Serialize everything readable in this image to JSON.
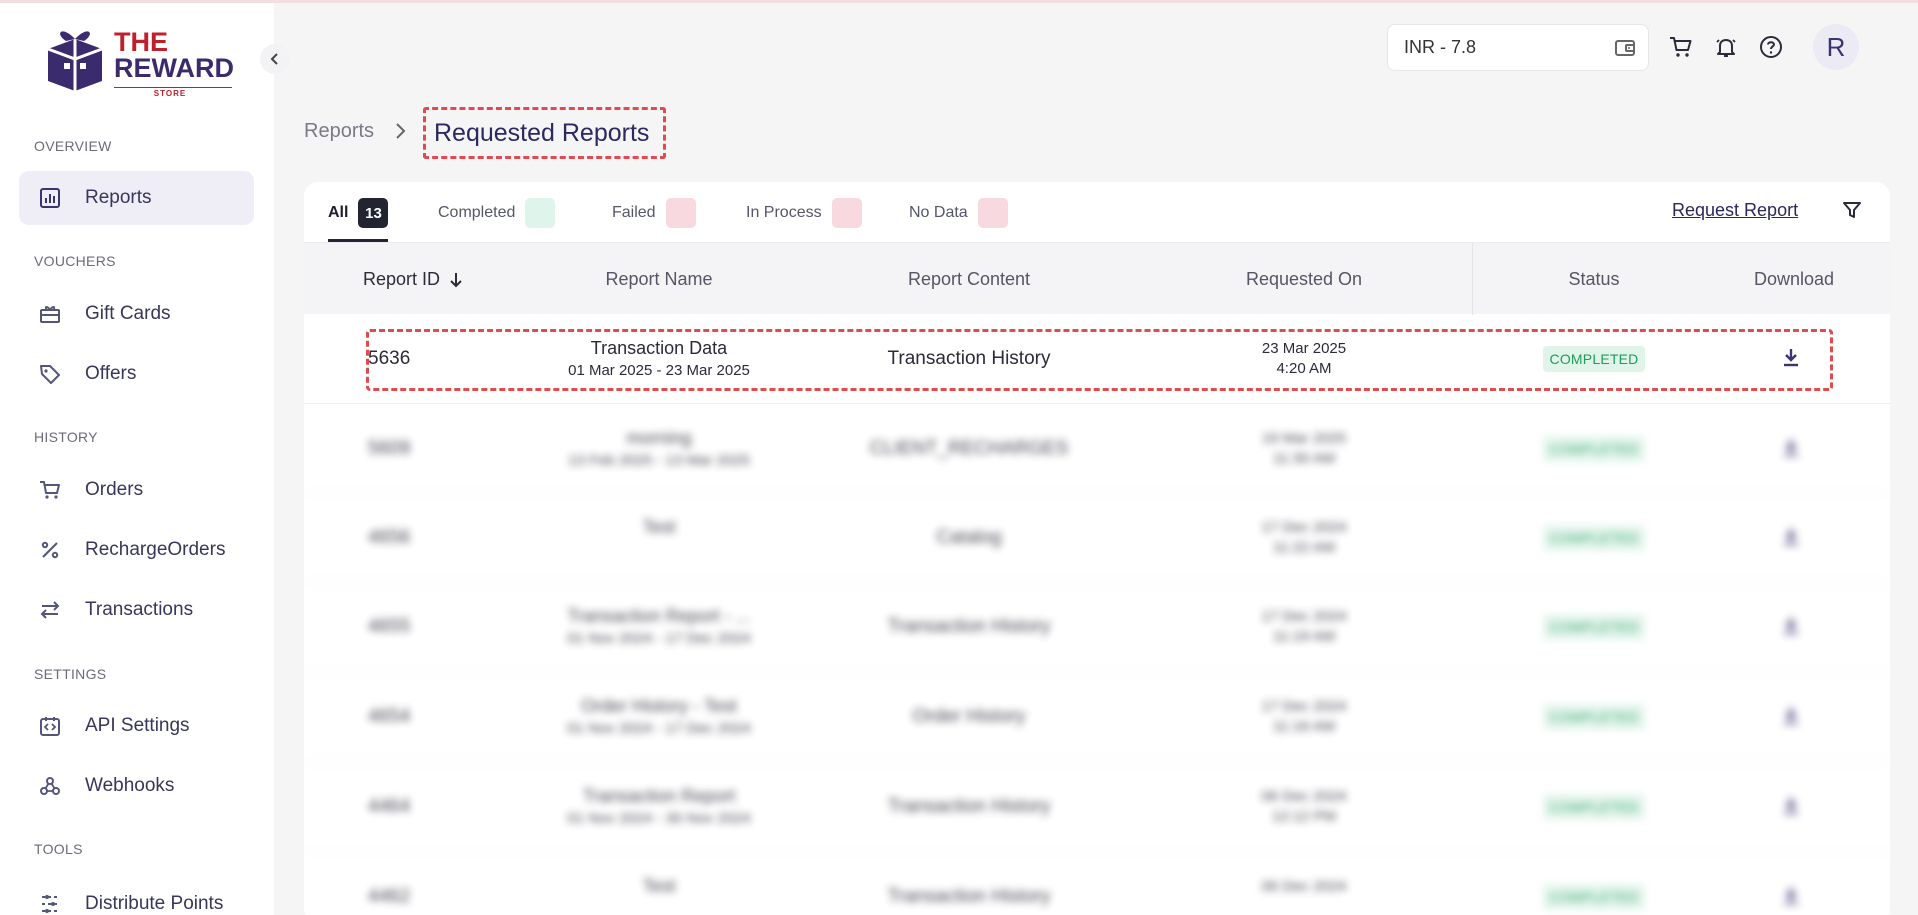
{
  "brand": {
    "line1": "THE",
    "line2": "REWARD",
    "tagline": "STORE"
  },
  "sidebar": {
    "sections": [
      {
        "title": "OVERVIEW",
        "items": [
          {
            "label": "Reports",
            "icon": "reports-icon",
            "active": true
          }
        ]
      },
      {
        "title": "VOUCHERS",
        "items": [
          {
            "label": "Gift Cards",
            "icon": "gift-card-icon"
          },
          {
            "label": "Offers",
            "icon": "tag-icon"
          }
        ]
      },
      {
        "title": "HISTORY",
        "items": [
          {
            "label": "Orders",
            "icon": "cart-icon"
          },
          {
            "label": "RechargeOrders",
            "icon": "percent-icon"
          },
          {
            "label": "Transactions",
            "icon": "swap-icon"
          }
        ]
      },
      {
        "title": "SETTINGS",
        "items": [
          {
            "label": "API Settings",
            "icon": "api-icon"
          },
          {
            "label": "Webhooks",
            "icon": "webhook-icon"
          }
        ]
      },
      {
        "title": "TOOLS",
        "items": [
          {
            "label": "Distribute Points",
            "icon": "distribute-icon"
          }
        ]
      }
    ]
  },
  "header": {
    "balance": "INR - 7.8",
    "avatar_initial": "R",
    "icons": [
      "wallet-icon",
      "cart-icon",
      "bell-icon",
      "help-icon"
    ]
  },
  "breadcrumb": {
    "root": "Reports",
    "current": "Requested Reports"
  },
  "tabs": [
    {
      "label": "All",
      "count": "13",
      "active": true
    },
    {
      "label": "Completed",
      "count": "",
      "chip": "green"
    },
    {
      "label": "Failed",
      "count": "",
      "chip": "red"
    },
    {
      "label": "In Process",
      "count": "",
      "chip": "red"
    },
    {
      "label": "No Data",
      "count": "",
      "chip": "red"
    }
  ],
  "actions": {
    "request_report": "Request Report"
  },
  "table": {
    "columns": [
      "Report ID",
      "Report Name",
      "Report Content",
      "Requested On",
      "Status",
      "Download"
    ],
    "rows": [
      {
        "id": "5636",
        "name": "Transaction Data",
        "range": "01 Mar 2025 - 23 Mar 2025",
        "content": "Transaction History",
        "date": "23 Mar 2025",
        "time": "4:20 AM",
        "status": "COMPLETED",
        "blurred": false
      },
      {
        "id": "5609",
        "name": "morning",
        "range": "13 Feb 2025 - 13 Mar 2025",
        "content": "CLIENT_RECHARGES",
        "date": "19 Mar 2025",
        "time": "11:30 AM",
        "status": "COMPLETED",
        "blurred": true
      },
      {
        "id": "4656",
        "name": "Test",
        "range": "",
        "content": "Catalog",
        "date": "17 Dec 2024",
        "time": "11:22 AM",
        "status": "COMPLETED",
        "blurred": true
      },
      {
        "id": "4655",
        "name": "Transaction Report - ...",
        "range": "01 Nov 2024 - 17 Dec 2024",
        "content": "Transaction History",
        "date": "17 Dec 2024",
        "time": "11:19 AM",
        "status": "COMPLETED",
        "blurred": true
      },
      {
        "id": "4654",
        "name": "Order History - Test",
        "range": "01 Nov 2024 - 17 Dec 2024",
        "content": "Order History",
        "date": "17 Dec 2024",
        "time": "11:16 AM",
        "status": "COMPLETED",
        "blurred": true
      },
      {
        "id": "4464",
        "name": "Transaction Report",
        "range": "01 Nov 2024 - 30 Nov 2024",
        "content": "Transaction History",
        "date": "06 Dec 2024",
        "time": "12:12 PM",
        "status": "COMPLETED",
        "blurred": true
      },
      {
        "id": "4462",
        "name": "Test",
        "range": "",
        "content": "Transaction History",
        "date": "06 Dec 2024",
        "time": "",
        "status": "COMPLETED",
        "blurred": true
      }
    ]
  },
  "colors": {
    "accent": "#2e2860",
    "brand_red": "#c0202c",
    "highlight": "#e14a4f",
    "success": "#1e9c5c"
  }
}
